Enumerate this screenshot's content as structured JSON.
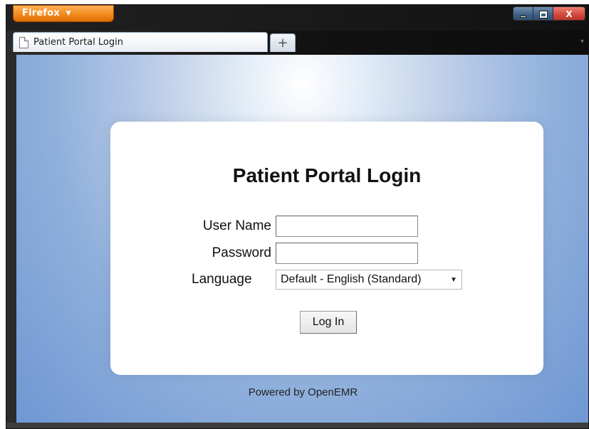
{
  "browser": {
    "menu_button_label": "Firefox",
    "tab_title": "Patient Portal Login",
    "new_tab_label": "+",
    "close_label": "X"
  },
  "login": {
    "title": "Patient Portal Login",
    "username_label": "User Name",
    "username_value": "",
    "password_label": "Password",
    "password_value": "",
    "language_label": "Language",
    "language_selected": "Default - English (Standard)",
    "submit_label": "Log In"
  },
  "footer": {
    "powered_by": "Powered by OpenEMR"
  },
  "icons": {
    "page": "page-icon",
    "new_tab": "plus-icon",
    "dropdown": "chevron-down-icon",
    "minimize": "minimize-icon",
    "maximize": "maximize-icon",
    "close": "close-icon"
  },
  "colors": {
    "firefox_button": "#f28a1c",
    "close_button": "#d0473b",
    "background_blue": "#6f97d3",
    "card_background": "#ffffff"
  }
}
